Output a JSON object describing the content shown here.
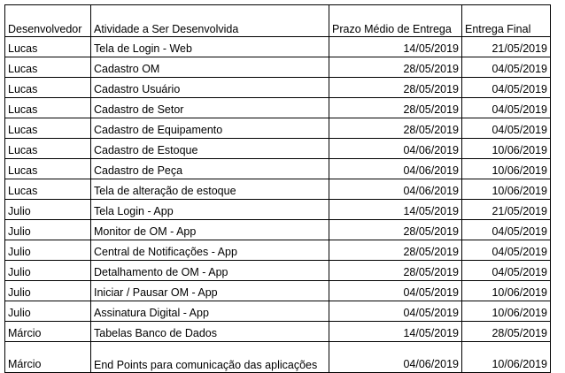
{
  "table": {
    "headers": {
      "developer": "Desenvolvedor",
      "activity": "Atividade a Ser Desenvolvida",
      "avg_deadline": "Prazo Médio de Entrega",
      "final_delivery": "Entrega Final"
    },
    "rows": [
      {
        "developer": "Lucas",
        "activity": "Tela de Login - Web",
        "avg_deadline": "14/05/2019",
        "final_delivery": "21/05/2019"
      },
      {
        "developer": "Lucas",
        "activity": "Cadastro OM",
        "avg_deadline": "28/05/2019",
        "final_delivery": "04/05/2019"
      },
      {
        "developer": "Lucas",
        "activity": "Cadastro Usuário",
        "avg_deadline": "28/05/2019",
        "final_delivery": "04/05/2019"
      },
      {
        "developer": "Lucas",
        "activity": "Cadastro de Setor",
        "avg_deadline": "28/05/2019",
        "final_delivery": "04/05/2019"
      },
      {
        "developer": "Lucas",
        "activity": "Cadastro de Equipamento",
        "avg_deadline": "28/05/2019",
        "final_delivery": "04/05/2019"
      },
      {
        "developer": "Lucas",
        "activity": "Cadastro de Estoque",
        "avg_deadline": "04/06/2019",
        "final_delivery": "10/06/2019"
      },
      {
        "developer": "Lucas",
        "activity": "Cadastro de Peça",
        "avg_deadline": "04/06/2019",
        "final_delivery": "10/06/2019"
      },
      {
        "developer": "Lucas",
        "activity": "Tela de alteração de estoque",
        "avg_deadline": "04/06/2019",
        "final_delivery": "10/06/2019"
      },
      {
        "developer": "Julio",
        "activity": "Tela Login - App",
        "avg_deadline": "14/05/2019",
        "final_delivery": "21/05/2019"
      },
      {
        "developer": "Julio",
        "activity": "Monitor de OM - App",
        "avg_deadline": "28/05/2019",
        "final_delivery": "04/05/2019"
      },
      {
        "developer": "Julio",
        "activity": "Central de Notificações - App",
        "avg_deadline": "28/05/2019",
        "final_delivery": "04/05/2019"
      },
      {
        "developer": "Julio",
        "activity": "Detalhamento de OM - App",
        "avg_deadline": "28/05/2019",
        "final_delivery": "04/05/2019"
      },
      {
        "developer": "Julio",
        "activity": "Iniciar / Pausar OM - App",
        "avg_deadline": "04/05/2019",
        "final_delivery": "10/06/2019"
      },
      {
        "developer": "Julio",
        "activity": "Assinatura Digital - App",
        "avg_deadline": "04/05/2019",
        "final_delivery": "10/06/2019"
      },
      {
        "developer": "Márcio",
        "activity": "Tabelas Banco de Dados",
        "avg_deadline": "14/05/2019",
        "final_delivery": "28/05/2019"
      },
      {
        "developer": "Márcio",
        "activity": "End Points para comunicação das aplicações",
        "avg_deadline": "04/06/2019",
        "final_delivery": "10/06/2019"
      }
    ]
  }
}
